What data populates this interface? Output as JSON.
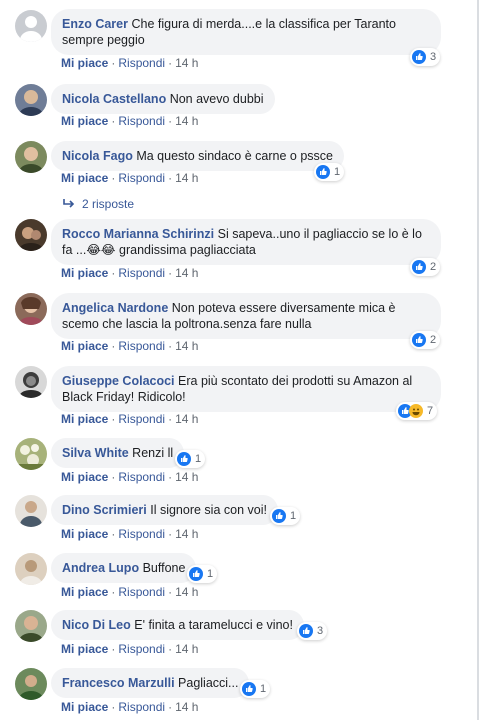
{
  "ui": {
    "like_label": "Mi piace",
    "reply_label": "Rispondi",
    "dot": "·"
  },
  "comments": [
    {
      "author": "Enzo Carer",
      "text": "Che figura di merda....e la classifica per Taranto sempre peggio",
      "time": "14 h",
      "reactions": "3",
      "avatar_color": "#c9ccd1"
    },
    {
      "author": "Nicola Castellano",
      "text": "Non avevo dubbi",
      "time": "14 h",
      "reactions": "",
      "avatar_color": "#6f7d97"
    },
    {
      "author": "Nicola Fago",
      "text": "Ma questo sindaco è carne o pssce",
      "time": "14 h",
      "reactions": "1",
      "avatar_color": "#7c8a5e"
    },
    {
      "author": "Rocco Marianna Schirinzi",
      "text": "Si sapeva..uno il pagliaccio se lo è lo fa ...😂😂 grandissima pagliacciata",
      "time": "14 h",
      "reactions": "2",
      "avatar_color": "#4a3a2c"
    },
    {
      "author": "Angelica Nardone",
      "text": "Non poteva essere diversamente mica è scemo che lascia la poltrona.senza fare nulla",
      "time": "14 h",
      "reactions": "2",
      "avatar_color": "#8b6a5a"
    },
    {
      "author": "Giuseppe Colacoci",
      "text": "Era più scontato dei prodotti su Amazon al Black Friday! Ridicolo!",
      "time": "14 h",
      "reactions": "7",
      "avatar_color": "#3c3c3c"
    },
    {
      "author": "Silva White",
      "text": "Renzi ll",
      "time": "14 h",
      "reactions": "1",
      "avatar_color": "#a7b27a"
    },
    {
      "author": "Dino Scrimieri",
      "text": "Il signore sia con voi!",
      "time": "14 h",
      "reactions": "1",
      "avatar_color": "#c9b49b"
    },
    {
      "author": "Andrea Lupo",
      "text": "Buffone",
      "time": "14 h",
      "reactions": "1",
      "avatar_color": "#b89a7a"
    },
    {
      "author": "Nico Di Leo",
      "text": "E' finita a taramelucci e vino!",
      "time": "14 h",
      "reactions": "3",
      "avatar_color": "#7d8b6a"
    },
    {
      "author": "Francesco Marzulli",
      "text": "Pagliacci...",
      "time": "14 h",
      "reactions": "1",
      "avatar_color": "#4f7a3c"
    }
  ],
  "replies_link": "2 risposte",
  "colors": {
    "like_blue": "#1877f2",
    "haha_yellow": "#f7b928",
    "link": "#385898"
  }
}
